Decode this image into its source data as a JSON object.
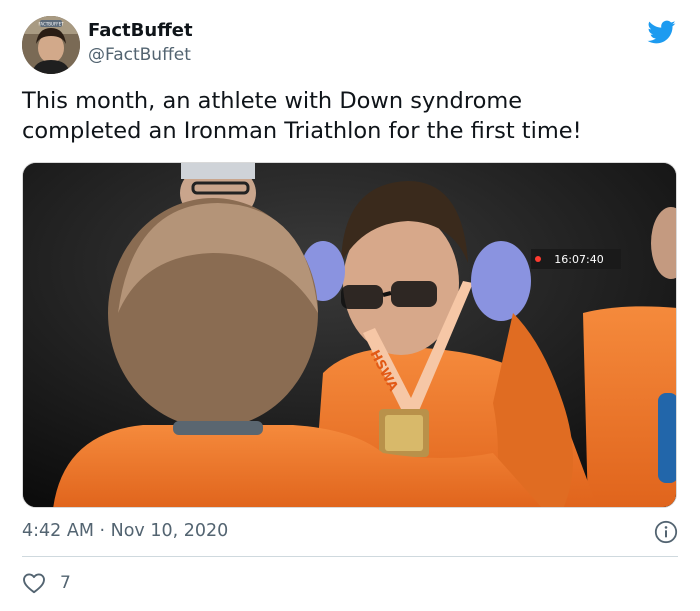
{
  "author": {
    "name": "FactBuffet",
    "handle": "@FactBuffet",
    "avatar_badge_text": "FACTBUFFET"
  },
  "tweet": {
    "text": "This month, an athlete with Down syndrome\ncompleted an Ironman Triathlon for the first time!"
  },
  "photo": {
    "clock_text": "16:07:40",
    "lanyard_text": "HSWA"
  },
  "meta": {
    "timestamp": "4:42 AM · Nov 10, 2020",
    "like_count": "7"
  },
  "icons": {
    "brand": "twitter-bird-icon",
    "info": "info-icon",
    "like": "heart-icon"
  },
  "colors": {
    "twitter_blue": "#1d9bf0",
    "text_primary": "#0f1419",
    "text_secondary": "#536471",
    "divider": "#cfd9de",
    "shirt_orange": "#f07a2a"
  }
}
